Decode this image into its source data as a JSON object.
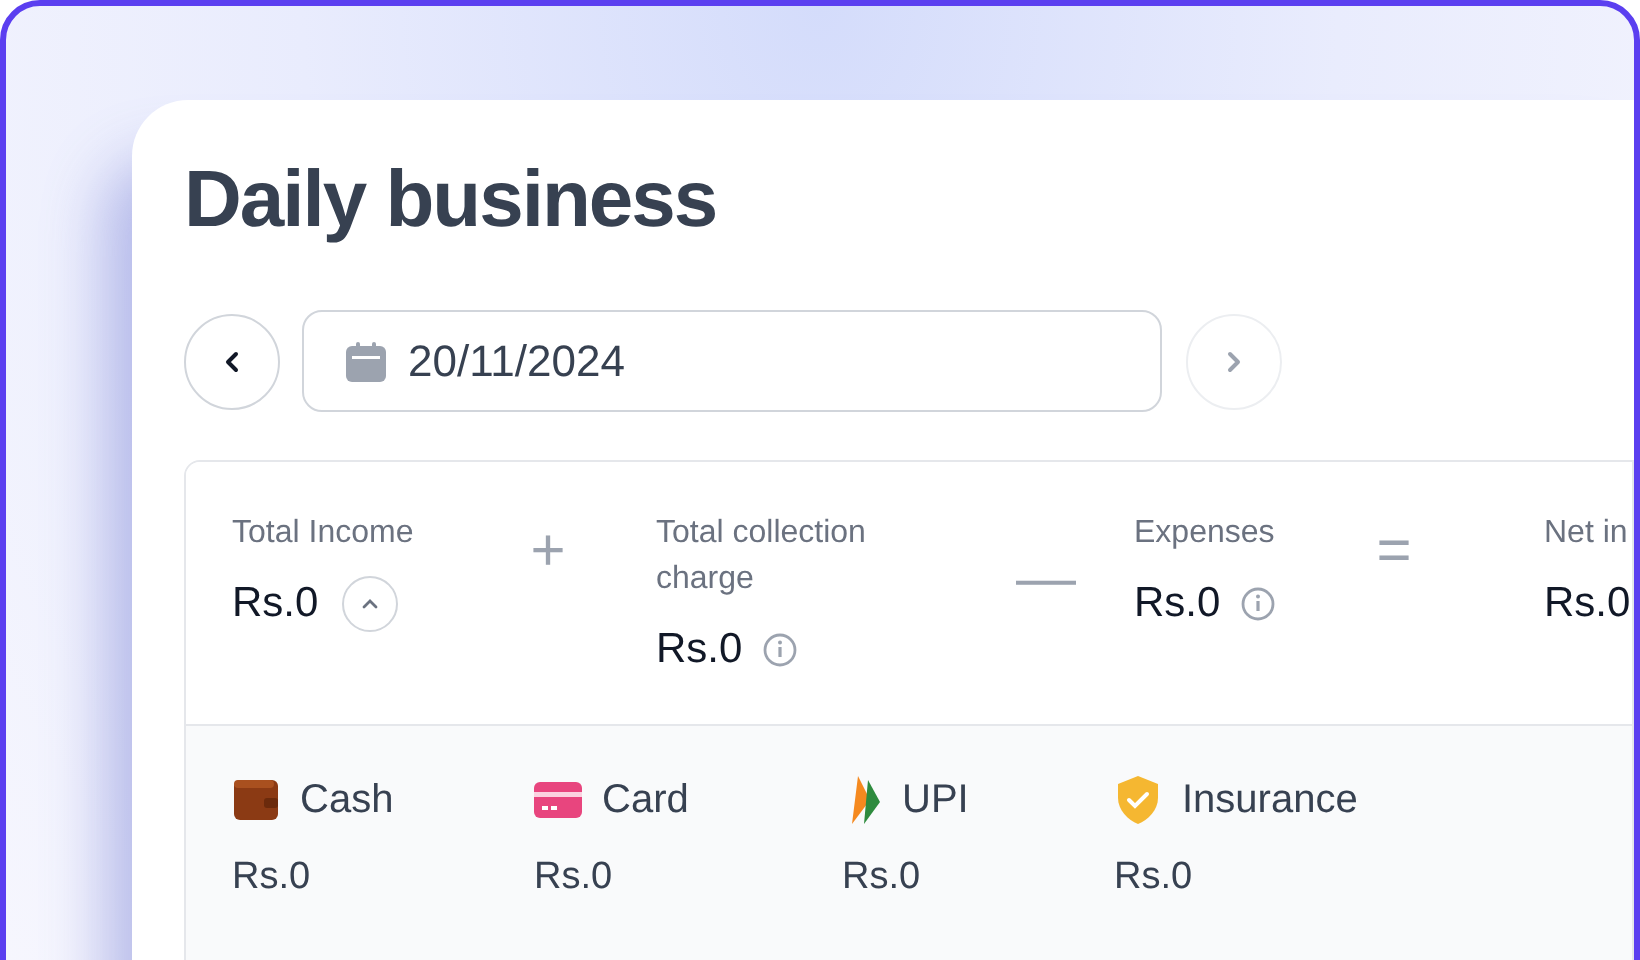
{
  "page": {
    "title": "Daily business"
  },
  "date_nav": {
    "previous": {
      "disabled": false
    },
    "date": "20/11/2024",
    "next": {
      "disabled": true
    }
  },
  "summary": [
    {
      "kind": "metric",
      "label": "Total Income",
      "value": "Rs.0",
      "toggle": {
        "expanded": true
      }
    },
    {
      "kind": "operator",
      "text": "+"
    },
    {
      "kind": "metric",
      "label": "Total collection charge",
      "value": "Rs.0",
      "info": true
    },
    {
      "kind": "operator",
      "text": "—"
    },
    {
      "kind": "metric",
      "label": "Expenses",
      "value": "Rs.0",
      "info": true
    },
    {
      "kind": "operator",
      "text": "="
    },
    {
      "kind": "metric",
      "label": "Net in",
      "value": "Rs.0"
    }
  ],
  "payment_methods": [
    {
      "kind": "wallet",
      "name": "Cash",
      "value": "Rs.0"
    },
    {
      "kind": "card",
      "name": "Card",
      "value": "Rs.0"
    },
    {
      "kind": "upi",
      "name": "UPI",
      "value": "Rs.0"
    },
    {
      "kind": "shield",
      "name": "Insurance",
      "value": "Rs.0"
    }
  ]
}
